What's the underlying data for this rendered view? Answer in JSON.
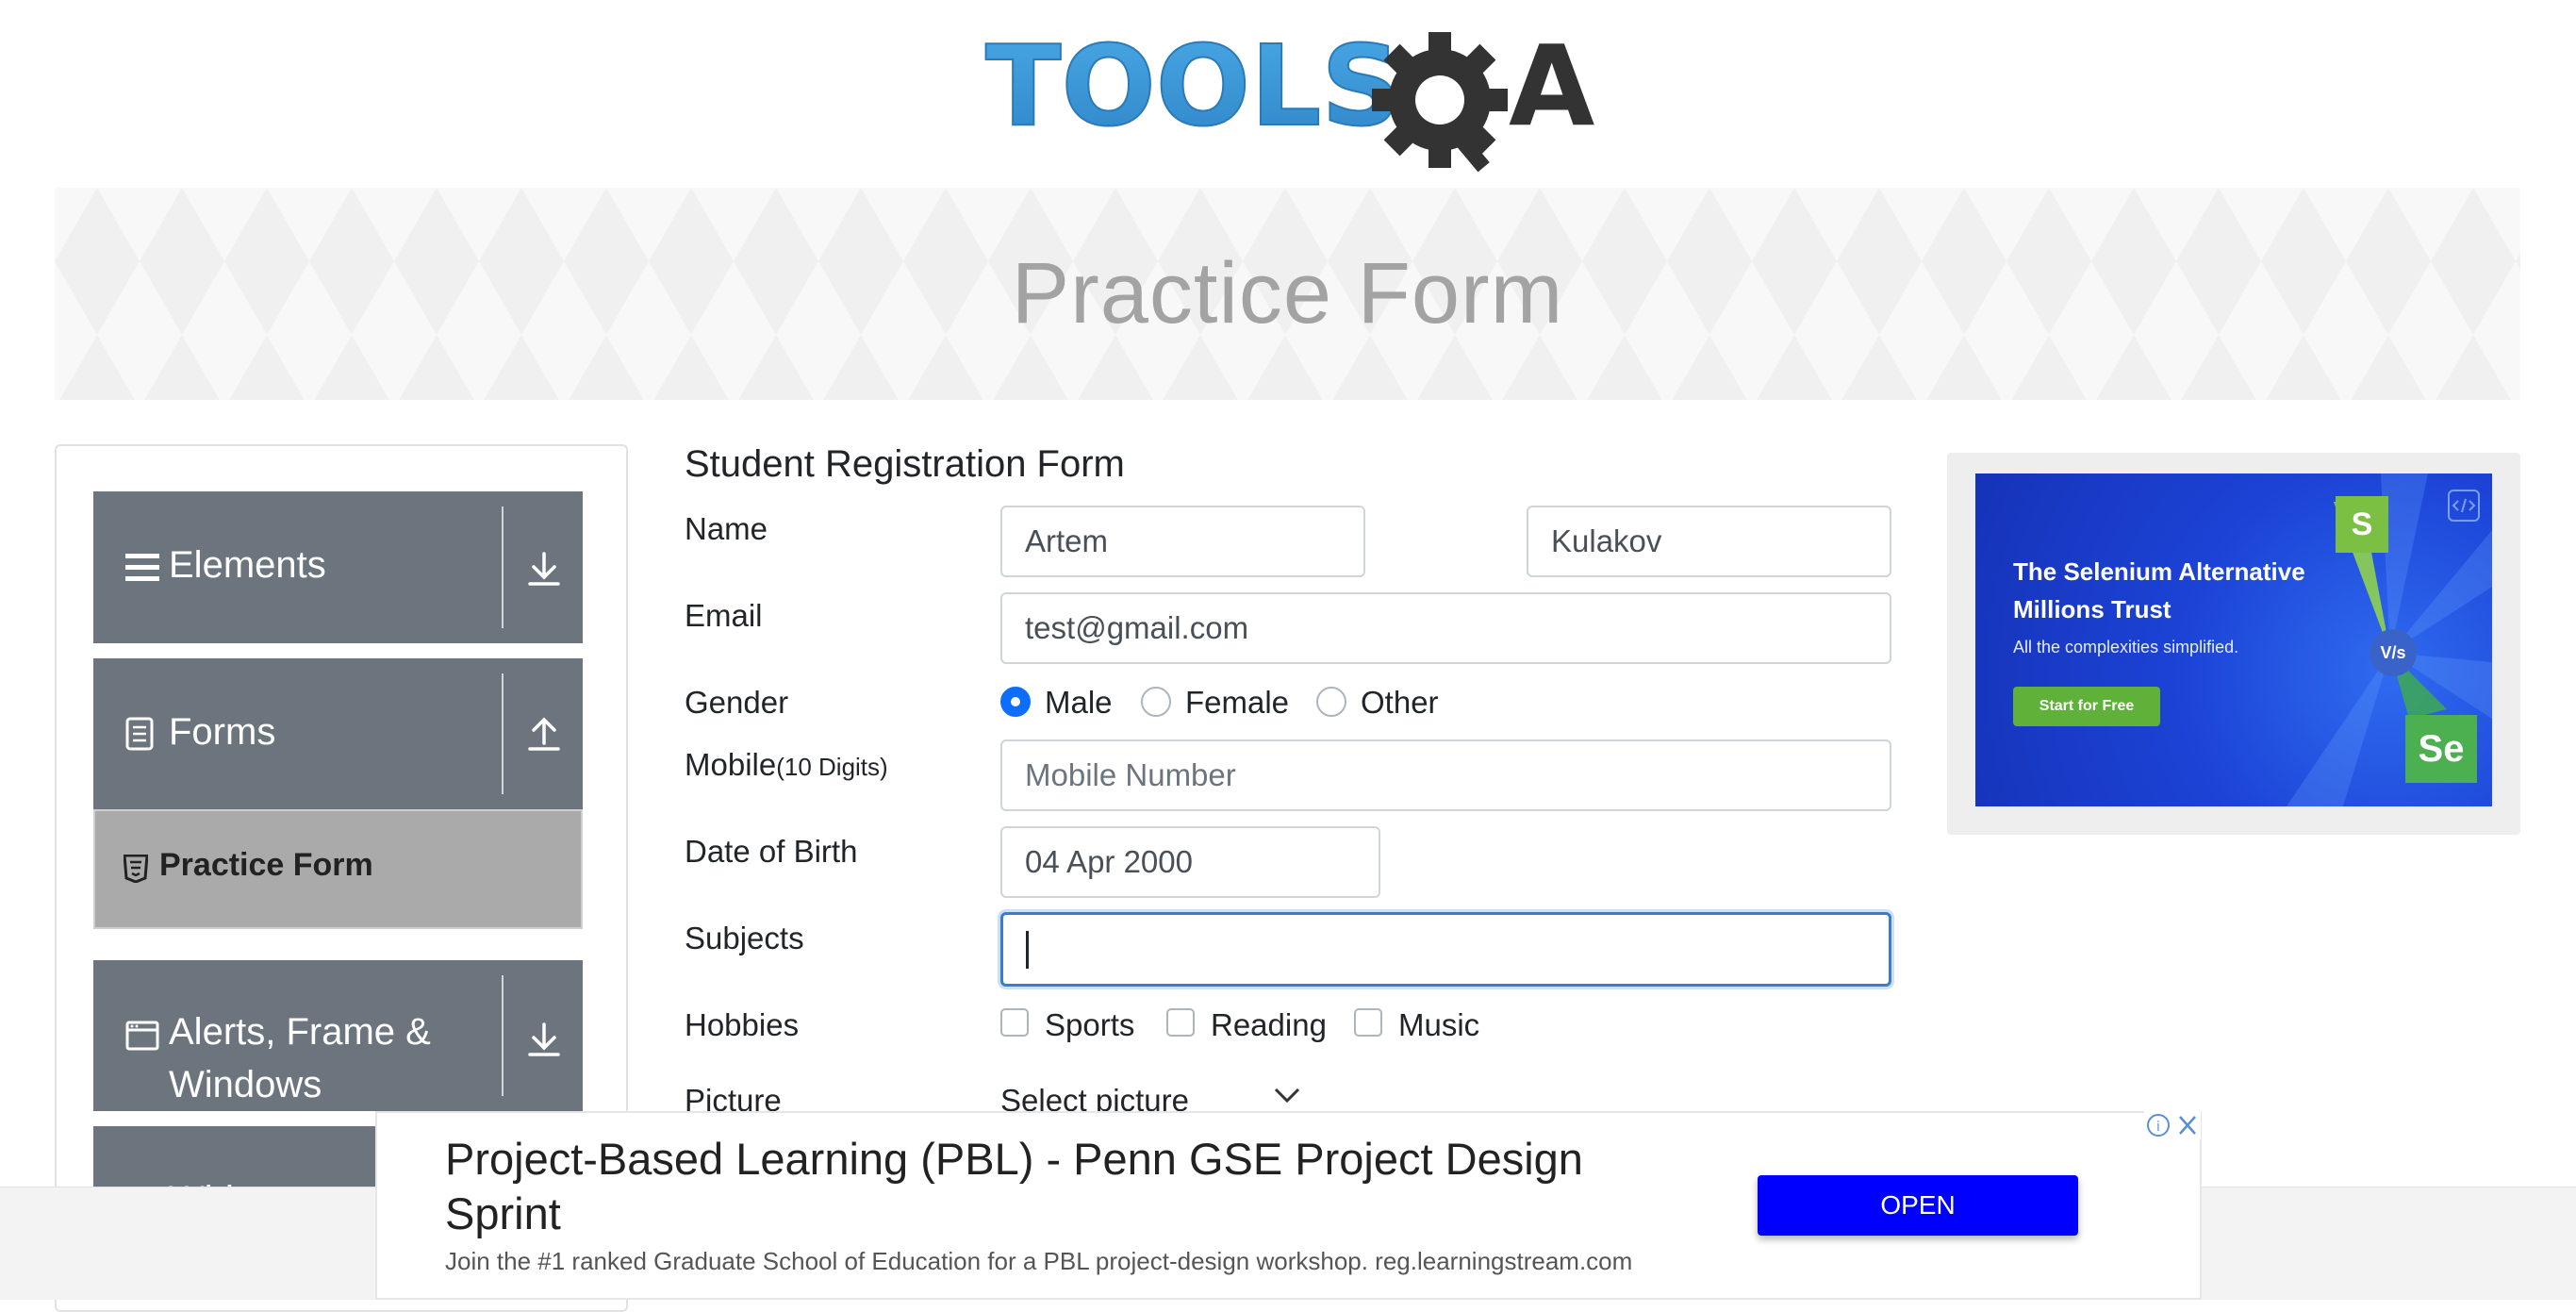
{
  "logo": {
    "text_left": "TOOLS",
    "text_right": "QA"
  },
  "banner": {
    "title": "Practice Form"
  },
  "sidebar": {
    "groups": [
      {
        "label": "Elements",
        "icon": "hamburger-icon",
        "arrow": "download-arrow-icon"
      },
      {
        "label": "Forms",
        "icon": "document-icon",
        "arrow": "upload-arrow-icon"
      },
      {
        "label_line1": "Alerts, Frame &",
        "label_line2": "Windows",
        "icon": "window-icon",
        "arrow": "download-arrow-icon"
      },
      {
        "label": "Widgets"
      }
    ],
    "active_item": {
      "label": "Practice Form",
      "icon": "html5-icon"
    }
  },
  "form": {
    "title": "Student Registration Form",
    "name": {
      "label": "Name",
      "first_value": "Artem",
      "last_value": "Kulakov"
    },
    "email": {
      "label": "Email",
      "value": "test@gmail.com"
    },
    "gender": {
      "label": "Gender",
      "options": [
        "Male",
        "Female",
        "Other"
      ],
      "selected": "Male"
    },
    "mobile": {
      "label": "Mobile",
      "hint": "(10 Digits)",
      "placeholder": "Mobile Number"
    },
    "dob": {
      "label": "Date of Birth",
      "value": "04 Apr 2000"
    },
    "subjects": {
      "label": "Subjects",
      "value": ""
    },
    "hobbies": {
      "label": "Hobbies",
      "options": [
        "Sports",
        "Reading",
        "Music"
      ]
    },
    "picture": {
      "label": "Picture",
      "select_label": "Select picture"
    }
  },
  "ad_right": {
    "headline_line1": "The Selenium Alternative",
    "headline_line2": "Millions Trust",
    "sub": "All the complexities simplified.",
    "cta": "Start for Free",
    "badge_s": "S",
    "badge_vs": "V/s",
    "badge_se": "Se"
  },
  "ad_bottom": {
    "title_line1": "Project-Based Learning (PBL) - Penn GSE Project Design",
    "title_line2": "Sprint",
    "desc": "Join the #1 ranked Graduate School of Education for a PBL project-design workshop. reg.learningstream.com",
    "button": "OPEN"
  },
  "colors": {
    "sidebar_group": "#6c757d",
    "active_item": "#aaaaaa",
    "accent": "#0d6efd",
    "ad_button": "#0000ff",
    "logo_blue": "#3d98d9",
    "logo_dark": "#333333"
  }
}
